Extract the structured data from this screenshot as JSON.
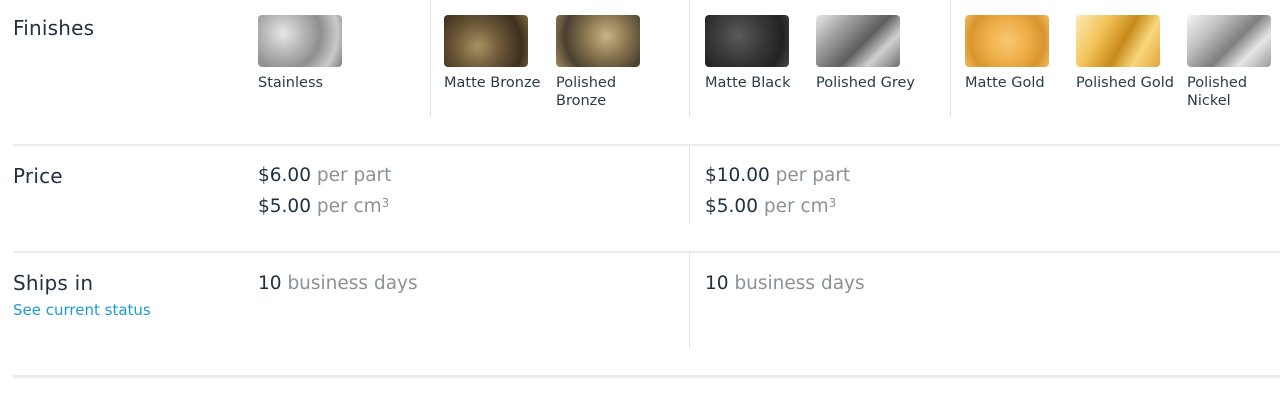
{
  "rows": {
    "finishes_label": "Finishes",
    "price_label": "Price",
    "ships_label": "Ships in",
    "ships_link": "See current status"
  },
  "finishes": [
    {
      "name": "Stainless",
      "color": "#a9a9a9"
    },
    {
      "name": "Matte Bronze",
      "color": "#6b5636"
    },
    {
      "name": "Polished Bronze",
      "color": "#8c7850"
    },
    {
      "name": "Matte Black",
      "color": "#3a3a3a"
    },
    {
      "name": "Polished Grey",
      "color": "#9a9a9a"
    },
    {
      "name": "Matte Gold",
      "color": "#efb04c"
    },
    {
      "name": "Polished Gold",
      "color": "#f3c45a"
    },
    {
      "name": "Polished Nickel",
      "color": "#bdbdbd"
    }
  ],
  "pricing": [
    {
      "per_part_amount": "$6.00",
      "per_part_unit": "per part",
      "per_cm_amount": "$5.00",
      "per_cm_unit": "per cm",
      "per_cm_exp": "3",
      "ships": {
        "count": "10",
        "unit": "business days"
      }
    },
    {
      "per_part_amount": "$10.00",
      "per_part_unit": "per part",
      "per_cm_amount": "$5.00",
      "per_cm_unit": "per cm",
      "per_cm_exp": "3",
      "ships": {
        "count": "10",
        "unit": "business days"
      }
    }
  ]
}
